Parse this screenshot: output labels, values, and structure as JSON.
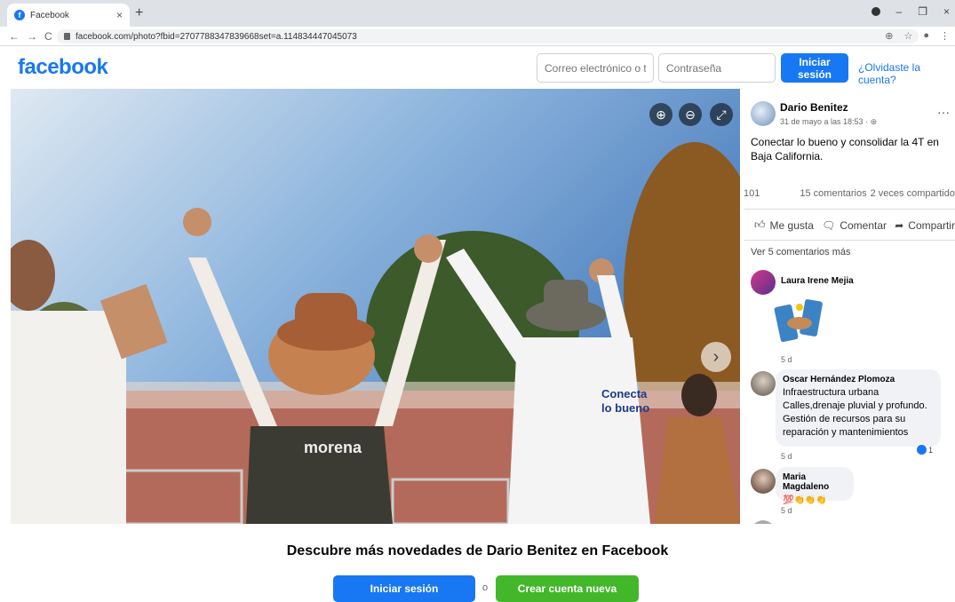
{
  "browser": {
    "tab_title": "Facebook",
    "url": "facebook.com/photo?fbid=2707788347839668set=a.114834447045073"
  },
  "header": {
    "logo": "facebook",
    "email_placeholder": "Correo electrónico o telé",
    "password_placeholder": "Contraseña",
    "login_label": "Iniciar sesión",
    "forgot_label": "¿Olvidaste la cuenta?"
  },
  "post": {
    "author": "Dario Benitez",
    "date": "31 de mayo a las 18:53 · ",
    "text": "Conectar lo bueno y consolidar la 4T en Baja California.",
    "reactions": "101",
    "comments_count": "15 comentarios",
    "shares_count": "2 veces compartido",
    "like_label": "Me gusta",
    "comment_label": "Comentar",
    "share_label": "Compartir",
    "see_more": "Ver 5 comentarios más"
  },
  "comments": [
    {
      "name": "Laura Irene Mejia",
      "time": "5 d"
    },
    {
      "name": "Oscar Hernández Plomoza",
      "text": "Infraestructura urbana Calles,drenaje pluvial y profundo. Gestión de recursos para su reparación y mantenimientos",
      "time": "5 d",
      "reactions": "1"
    },
    {
      "name": "Maria Magdaleno",
      "text": "💯👏👏👏",
      "time": "5 d"
    }
  ],
  "photo_signs": {
    "shirt_line1": "Conecta",
    "shirt_line2": "lo bueno",
    "vest": "morena"
  },
  "footer": {
    "title": "Descubre más novedades de Dario Benitez en Facebook",
    "login_label": "Iniciar sesión",
    "or_label": "o",
    "create_label": "Crear cuenta nueva"
  }
}
